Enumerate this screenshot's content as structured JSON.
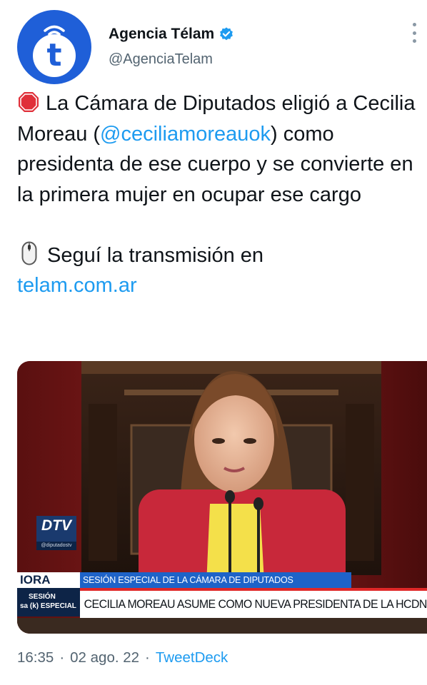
{
  "account": {
    "display_name": "Agencia Télam",
    "handle": "@AgenciaTelam",
    "avatar_letter": "t",
    "verified": true,
    "brand_color": "#1f5fd8",
    "verified_color": "#1d9bf0"
  },
  "tweet": {
    "emoji_1": "stop-sign",
    "text_1a": "La Cámara de Diputados eligió a Cecilia Moreau (",
    "mention": "@ceciliamoreauok",
    "text_1b": ") como presidenta de ese cuerpo y se convierte en la primera mujer en ocupar ese cargo",
    "emoji_2": "computer-mouse",
    "text_2": "Seguí la transmisión en",
    "link": "telam.com.ar"
  },
  "media": {
    "channel_logo": "DTV",
    "channel_sub": "@diputadostv",
    "ticker_left_top": "IORA",
    "ticker_left_bottom_1": "SESIÓN",
    "ticker_left_bottom_2": "ESPECIAL",
    "ticker_left_prefix": "sa (k)",
    "ticker_top": "SESIÓN ESPECIAL DE LA CÁMARA DE DIPUTADOS",
    "ticker_bottom": "CECILIA MOREAU ASUME COMO NUEVA PRESIDENTA DE LA HCDN"
  },
  "meta": {
    "time": "16:35",
    "date": "02 ago. 22",
    "separator": "·",
    "source": "TweetDeck"
  }
}
